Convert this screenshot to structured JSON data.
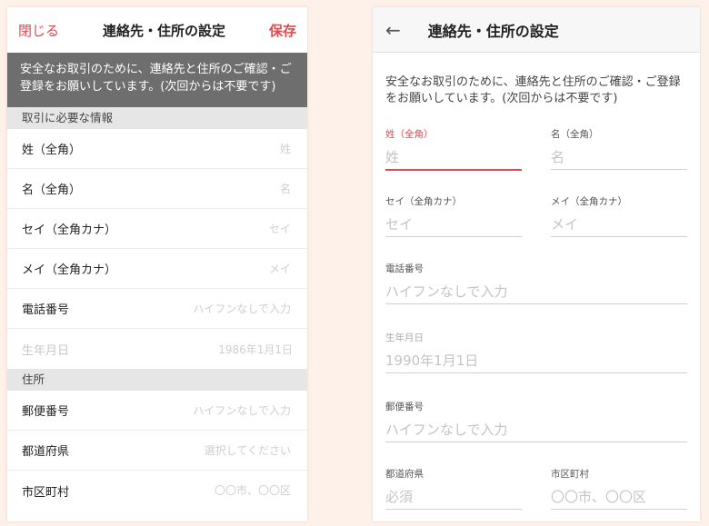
{
  "left": {
    "header": {
      "close": "閉じる",
      "title": "連絡先・住所の設定",
      "save": "保存"
    },
    "notice": "安全なお取引のために、連絡先と住所のご確認・ご登録をお願いしています。(次回からは不要です)",
    "section_required": "取引に必要な情報",
    "section_address": "住所",
    "rows": {
      "last_name": {
        "label": "姓（全角）",
        "placeholder": "姓"
      },
      "first_name": {
        "label": "名（全角）",
        "placeholder": "名"
      },
      "last_kana": {
        "label": "セイ（全角カナ）",
        "placeholder": "セイ"
      },
      "first_kana": {
        "label": "メイ（全角カナ）",
        "placeholder": "メイ"
      },
      "phone": {
        "label": "電話番号",
        "placeholder": "ハイフンなしで入力"
      },
      "birthday": {
        "label": "生年月日",
        "value": "1986年1月1日"
      },
      "postal": {
        "label": "郵便番号",
        "placeholder": "ハイフンなしで入力"
      },
      "prefecture": {
        "label": "都道府県",
        "placeholder": "選択してください"
      },
      "city": {
        "label": "市区町村",
        "placeholder": "〇〇市、〇〇区"
      }
    }
  },
  "right": {
    "header": {
      "title": "連絡先・住所の設定"
    },
    "notice": "安全なお取引のために、連絡先と住所のご確認・ご登録をお願いしています。(次回からは不要です)",
    "fields": {
      "last_name": {
        "label": "姓（全角）",
        "placeholder": "姓"
      },
      "first_name": {
        "label": "名（全角）",
        "placeholder": "名"
      },
      "last_kana": {
        "label": "セイ（全角カナ）",
        "placeholder": "セイ"
      },
      "first_kana": {
        "label": "メイ（全角カナ）",
        "placeholder": "メイ"
      },
      "phone": {
        "label": "電話番号",
        "placeholder": "ハイフンなしで入力"
      },
      "birthday": {
        "label": "生年月日",
        "placeholder": "1990年1月1日"
      },
      "postal": {
        "label": "郵便番号",
        "placeholder": "ハイフンなしで入力"
      },
      "prefecture": {
        "label": "都道府県",
        "placeholder": "必須"
      },
      "city": {
        "label": "市区町村",
        "placeholder": "〇〇市、〇〇区"
      }
    }
  },
  "colors": {
    "accent": "#e8474e",
    "notice_bg": "#6e6e6e",
    "section_bg": "#e6e6e6",
    "page_bg": "#fdf1ea"
  }
}
